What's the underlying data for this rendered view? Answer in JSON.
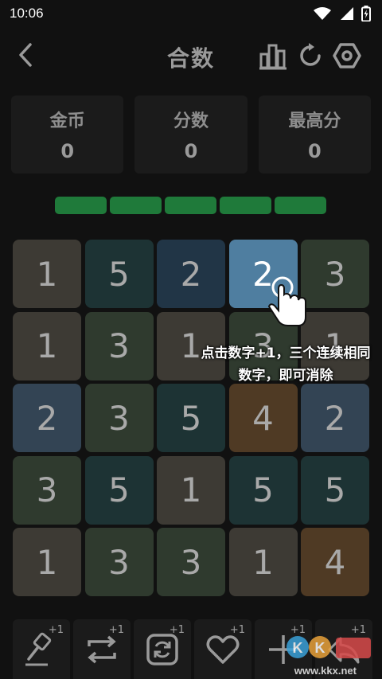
{
  "status_bar": {
    "time": "10:06"
  },
  "header": {
    "title": "合数"
  },
  "stats": [
    {
      "label": "金币",
      "value": "0"
    },
    {
      "label": "分数",
      "value": "0"
    },
    {
      "label": "最高分",
      "value": "0"
    }
  ],
  "progress": {
    "segments_filled": 5,
    "segments_total": 5,
    "color": "#1f7a3a"
  },
  "board": {
    "rows": [
      [
        "1",
        "5",
        "2",
        "2",
        "3"
      ],
      [
        "1",
        "3",
        "1",
        "3",
        "1"
      ],
      [
        "2",
        "3",
        "5",
        "4",
        "2"
      ],
      [
        "3",
        "5",
        "1",
        "5",
        "5"
      ],
      [
        "1",
        "3",
        "3",
        "1",
        "4"
      ]
    ],
    "selected": {
      "row": 0,
      "col": 3
    }
  },
  "hint": {
    "line1": "点击数字+1，三个连续相同",
    "line2": "数字，即可消除"
  },
  "toolbar": {
    "items": [
      {
        "icon": "hammer-icon",
        "count": "+1"
      },
      {
        "icon": "swap-icon",
        "count": "+1"
      },
      {
        "icon": "refresh-icon",
        "count": "+1"
      },
      {
        "icon": "heart-icon",
        "count": "+1"
      },
      {
        "icon": "plus-icon",
        "count": "+1"
      },
      {
        "icon": "undo-icon",
        "count": "+1"
      }
    ]
  },
  "watermark": {
    "text": "www.kkx.net"
  }
}
